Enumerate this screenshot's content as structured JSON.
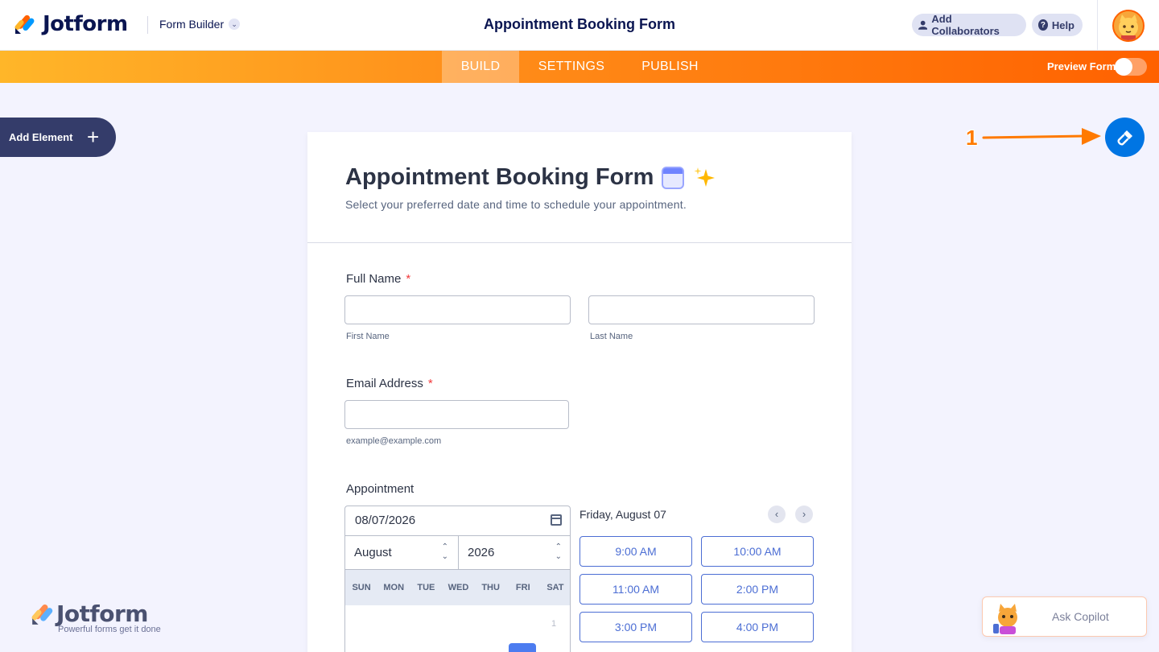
{
  "header": {
    "logo_text": "Jotform",
    "form_builder_label": "Form Builder",
    "center_title": "Appointment Booking Form",
    "add_collaborators_label": "Add Collaborators",
    "help_label": "Help"
  },
  "nav": {
    "tabs": [
      {
        "label": "BUILD",
        "active": true
      },
      {
        "label": "SETTINGS",
        "active": false
      },
      {
        "label": "PUBLISH",
        "active": false
      }
    ],
    "preview_label": "Preview Form",
    "preview_enabled": false
  },
  "sidebar": {
    "add_element_label": "Add Element",
    "add_icon": "plus-icon"
  },
  "annotation": {
    "number": "1"
  },
  "form": {
    "title": "Appointment Booking Form",
    "subtitle": "Select your preferred date and time to schedule your appointment.",
    "full_name": {
      "label": "Full Name",
      "required_mark": "*",
      "first_value": "",
      "last_value": "",
      "first_sublabel": "First Name",
      "last_sublabel": "Last Name"
    },
    "email": {
      "label": "Email Address",
      "required_mark": "*",
      "value": "",
      "sublabel": "example@example.com"
    },
    "appointment": {
      "label": "Appointment",
      "date_value": "08/07/2026",
      "month": "August",
      "year": "2026",
      "weekdays": [
        "SUN",
        "MON",
        "TUE",
        "WED",
        "THU",
        "FRI",
        "SAT"
      ],
      "first_day": "1",
      "selected_date_heading": "Friday, August 07",
      "prev_icon": "chevron-left-icon",
      "next_icon": "chevron-right-icon",
      "slots": [
        "9:00 AM",
        "10:00 AM",
        "11:00 AM",
        "2:00 PM",
        "3:00 PM",
        "4:00 PM"
      ]
    }
  },
  "watermark": {
    "logo_text": "Jotform",
    "tagline": "Powerful forms get it done"
  },
  "copilot": {
    "label": "Ask Copilot"
  },
  "colors": {
    "accent_orange": "#ff6100",
    "designer_blue": "#0075e3",
    "slot_blue": "#4c6ed4",
    "navy": "#0a1551"
  }
}
